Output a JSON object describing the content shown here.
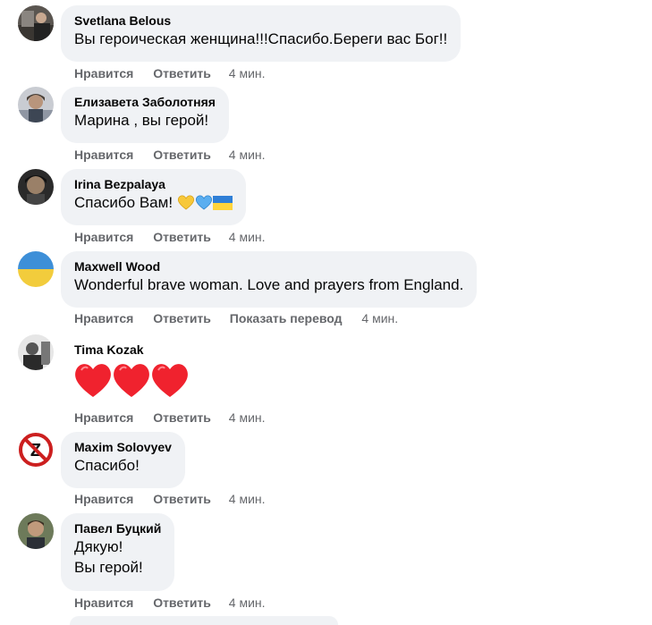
{
  "comments": [
    {
      "author": "Svetlana Belous",
      "text": "Вы героическая женщина!!!Спасибо.Береги вас Бог!!",
      "like": "Нравится",
      "reply": "Ответить",
      "time": "4 мин."
    },
    {
      "author": "Елизавета Заболотняя",
      "text": "Марина , вы герой!",
      "like": "Нравится",
      "reply": "Ответить",
      "time": "4 мин."
    },
    {
      "author": "Irina Bezpalaya",
      "text": "Спасибо Вам!",
      "emojis": [
        "yellow-heart",
        "blue-heart",
        "ukraine-flag"
      ],
      "like": "Нравится",
      "reply": "Ответить",
      "time": "4 мин."
    },
    {
      "author": "Maxwell Wood",
      "text": "Wonderful brave woman. Love and prayers from England.",
      "like": "Нравится",
      "reply": "Ответить",
      "translate": "Показать перевод",
      "time": "4 мин."
    },
    {
      "author": "Tima Kozak",
      "emojis": [
        "red-heart",
        "red-heart",
        "red-heart"
      ],
      "like": "Нравится",
      "reply": "Ответить",
      "time": "4 мин."
    },
    {
      "author": "Maxim Solovyev",
      "text": "Спасибо!",
      "like": "Нравится",
      "reply": "Ответить",
      "time": "4 мин."
    },
    {
      "author": "Павел Буцкий",
      "text_line1": "Дякую!",
      "text_line2": "Вы герой!",
      "like": "Нравится",
      "reply": "Ответить",
      "time": "4 мин."
    }
  ],
  "colors": {
    "bubble": "#f0f2f5",
    "secondary_text": "#65676b",
    "primary_text": "#050505"
  }
}
